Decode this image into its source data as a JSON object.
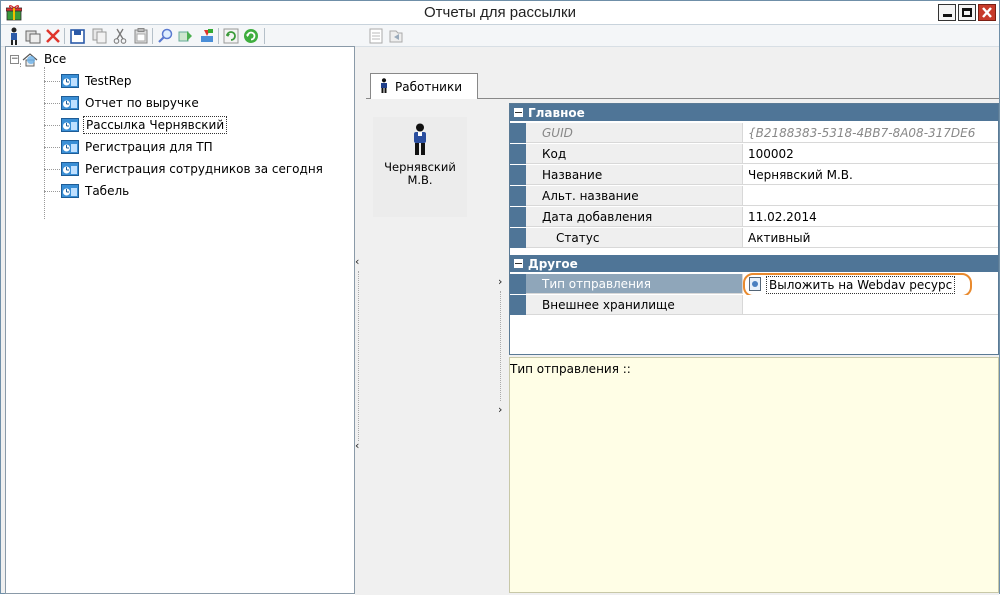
{
  "window": {
    "title": "Отчеты для рассылки"
  },
  "toolbar": {
    "icons": [
      "add-employee-icon",
      "copy-window-icon",
      "delete-icon",
      "save-icon",
      "copy-icon",
      "cut-icon",
      "paste-icon",
      "search-icon",
      "filter-icon",
      "import-icon",
      "refresh-icon",
      "sync-icon",
      "list-icon",
      "export-icon"
    ]
  },
  "tree": {
    "root_label": "Все",
    "items": [
      {
        "label": "TestRep"
      },
      {
        "label": "Отчет по выручке"
      },
      {
        "label": "Рассылка Чернявский"
      },
      {
        "label": "Регистрация для ТП"
      },
      {
        "label": "Регистрация сотрудников за сегодня"
      },
      {
        "label": "Табель"
      }
    ],
    "selected_index": 2
  },
  "tabs": {
    "employees_label": "Работники"
  },
  "employee_card": {
    "name": "Чернявский М.В."
  },
  "properties": {
    "main_category": "Главное",
    "other_category": "Другое",
    "rows": [
      {
        "name": "GUID",
        "value": "{B2188383-5318-4BB7-8A08-317DE6"
      },
      {
        "name": "Код",
        "value": "100002"
      },
      {
        "name": "Название",
        "value": "Чернявский М.В."
      },
      {
        "name": "Альт. название",
        "value": ""
      },
      {
        "name": "Дата добавления",
        "value": "11.02.2014"
      },
      {
        "name": "Статус",
        "value": "Активный"
      }
    ],
    "other_rows": [
      {
        "name": "Тип отправления",
        "value": "Выложить на Webdav ресурс"
      },
      {
        "name": "Внешнее хранилище",
        "value": ""
      }
    ]
  },
  "help": {
    "text": "Тип отправления ::"
  },
  "colors": {
    "category_bg": "#4f7597",
    "highlight": "#e98a2e",
    "help_bg": "#fffee6"
  }
}
